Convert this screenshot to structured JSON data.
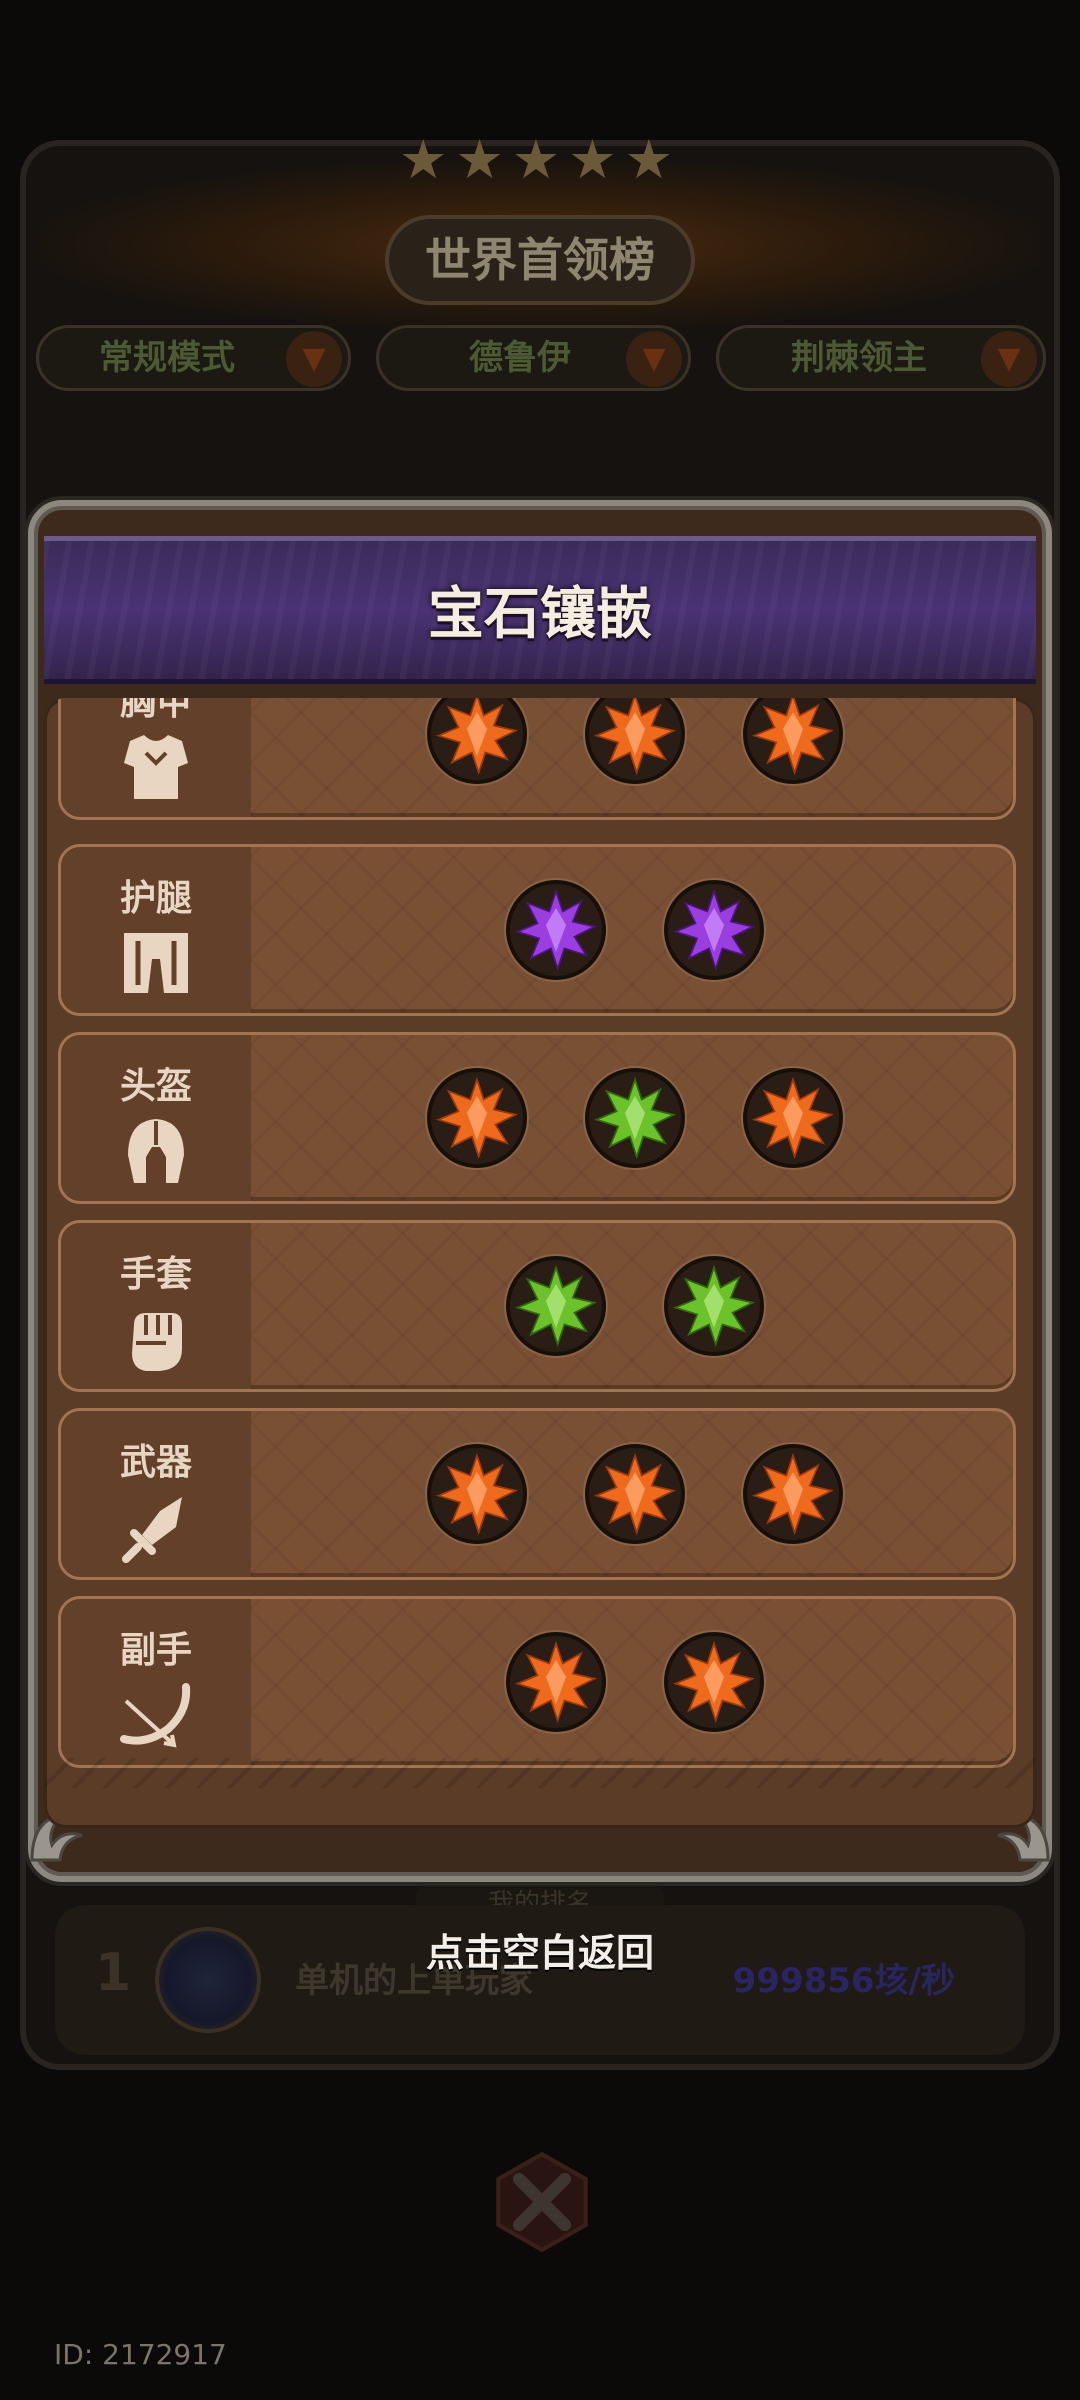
{
  "background": {
    "title": "世界首领榜",
    "tabs": [
      {
        "label": "常规模式"
      },
      {
        "label": "德鲁伊"
      },
      {
        "label": "荆棘领主"
      }
    ],
    "my_rank_label": "我的排名",
    "rank_row": {
      "rank": "1",
      "name": "单机的上单玩家",
      "score": "999856垓/秒"
    },
    "user_id": "ID: 2172917"
  },
  "modal": {
    "title": "宝石镶嵌",
    "slots": [
      {
        "label": "胸甲",
        "icon": "armor-icon",
        "gems": [
          "orange",
          "orange",
          "orange"
        ]
      },
      {
        "label": "护腿",
        "icon": "leggings-icon",
        "gems": [
          "purple",
          "purple"
        ]
      },
      {
        "label": "头盔",
        "icon": "helmet-icon",
        "gems": [
          "orange",
          "green",
          "orange"
        ]
      },
      {
        "label": "手套",
        "icon": "gloves-icon",
        "gems": [
          "green",
          "green"
        ]
      },
      {
        "label": "武器",
        "icon": "sword-icon",
        "gems": [
          "orange",
          "orange",
          "orange"
        ]
      },
      {
        "label": "副手",
        "icon": "bow-icon",
        "gems": [
          "orange",
          "orange"
        ]
      }
    ],
    "return_hint": "点击空白返回"
  },
  "colors": {
    "orange": "#f06a1e",
    "purple": "#9a3ee0",
    "green": "#6cc22a"
  }
}
